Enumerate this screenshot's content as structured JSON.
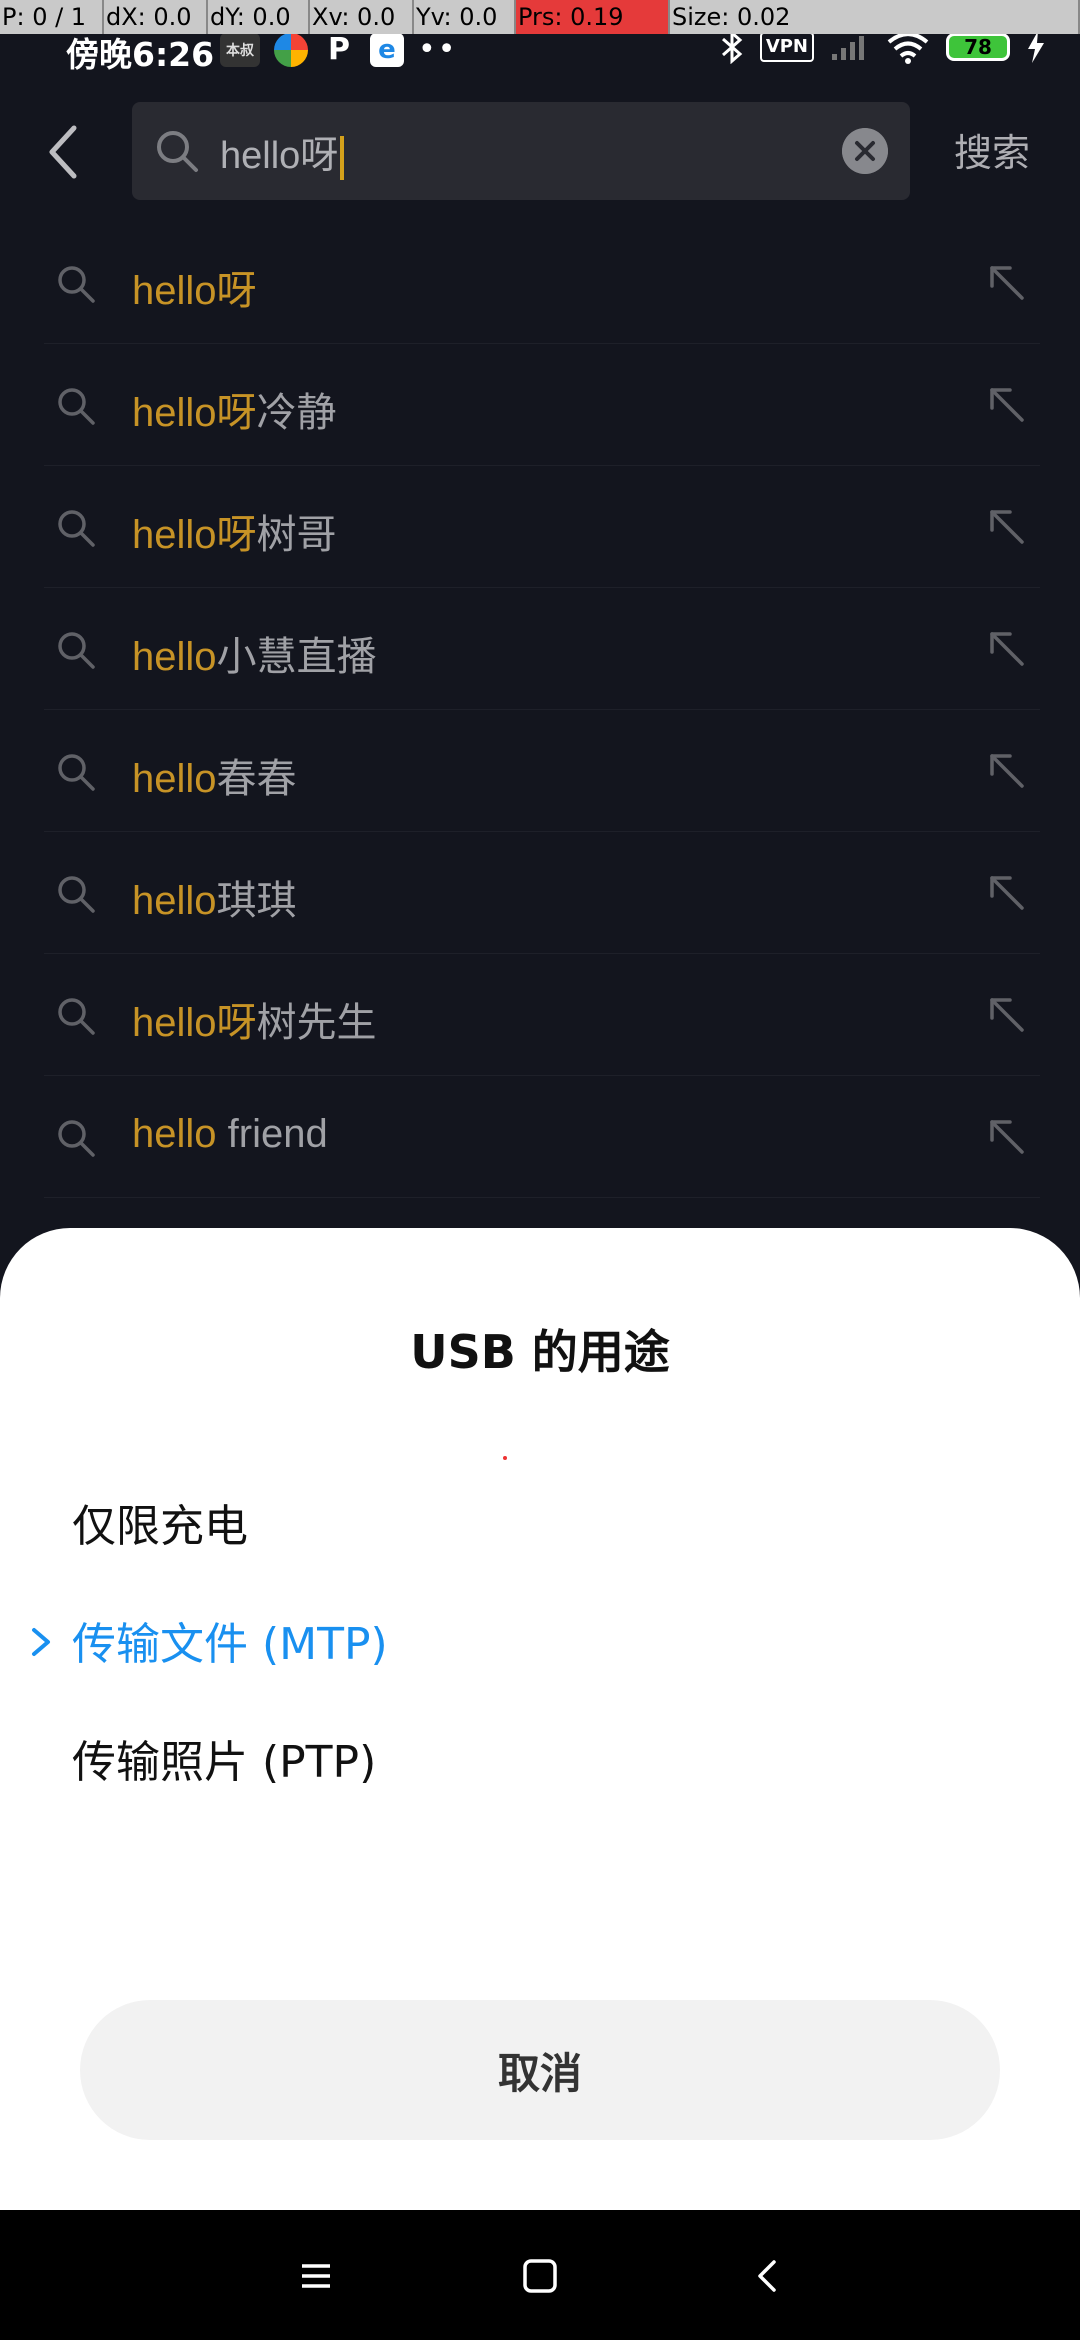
{
  "debug_bar": {
    "p": "P: 0 / 1",
    "dx": "dX: 0.0",
    "dy": "dY: 0.0",
    "xv": "Xv: 0.0",
    "yv": "Yv: 0.0",
    "prs": "Prs: 0.19",
    "size": "Size: 0.02"
  },
  "status_bar": {
    "time": "傍晚6:26",
    "notif_a": "本叔",
    "notif_c": "P",
    "notif_d": "e",
    "more": "••",
    "vpn": "VPN",
    "battery": "78"
  },
  "search": {
    "query": "hello呀",
    "submit_label": "搜索"
  },
  "suggestions": [
    {
      "highlight": "hello呀",
      "rest": ""
    },
    {
      "highlight": "hello呀",
      "rest": "冷静"
    },
    {
      "highlight": "hello呀",
      "rest": "树哥"
    },
    {
      "highlight": "hello",
      "rest": "小慧直播"
    },
    {
      "highlight": "hello",
      "rest": "春春"
    },
    {
      "highlight": "hello",
      "rest": "琪琪"
    },
    {
      "highlight": "hello呀",
      "rest": "树先生"
    },
    {
      "highlight": "hello",
      "rest": " friend"
    }
  ],
  "usb_dialog": {
    "title": "USB 的用途",
    "options": [
      {
        "label": "仅限充电",
        "selected": false
      },
      {
        "label": "传输文件 (MTP)",
        "selected": true
      },
      {
        "label": "传输照片 (PTP)",
        "selected": false
      }
    ],
    "cancel_label": "取消"
  },
  "colors": {
    "background": "#161823",
    "highlight": "#e3a82c",
    "selected_option": "#1990f0",
    "caret": "#f2b81f"
  },
  "icons": {
    "back": "chevron-left-icon",
    "search": "search-icon",
    "clear": "clear-circle-icon",
    "fill": "arrow-up-left-icon",
    "selected": "chevron-right-icon",
    "nav_menu": "menu-icon",
    "nav_home": "home-square-icon",
    "nav_back": "back-chevron-icon"
  }
}
